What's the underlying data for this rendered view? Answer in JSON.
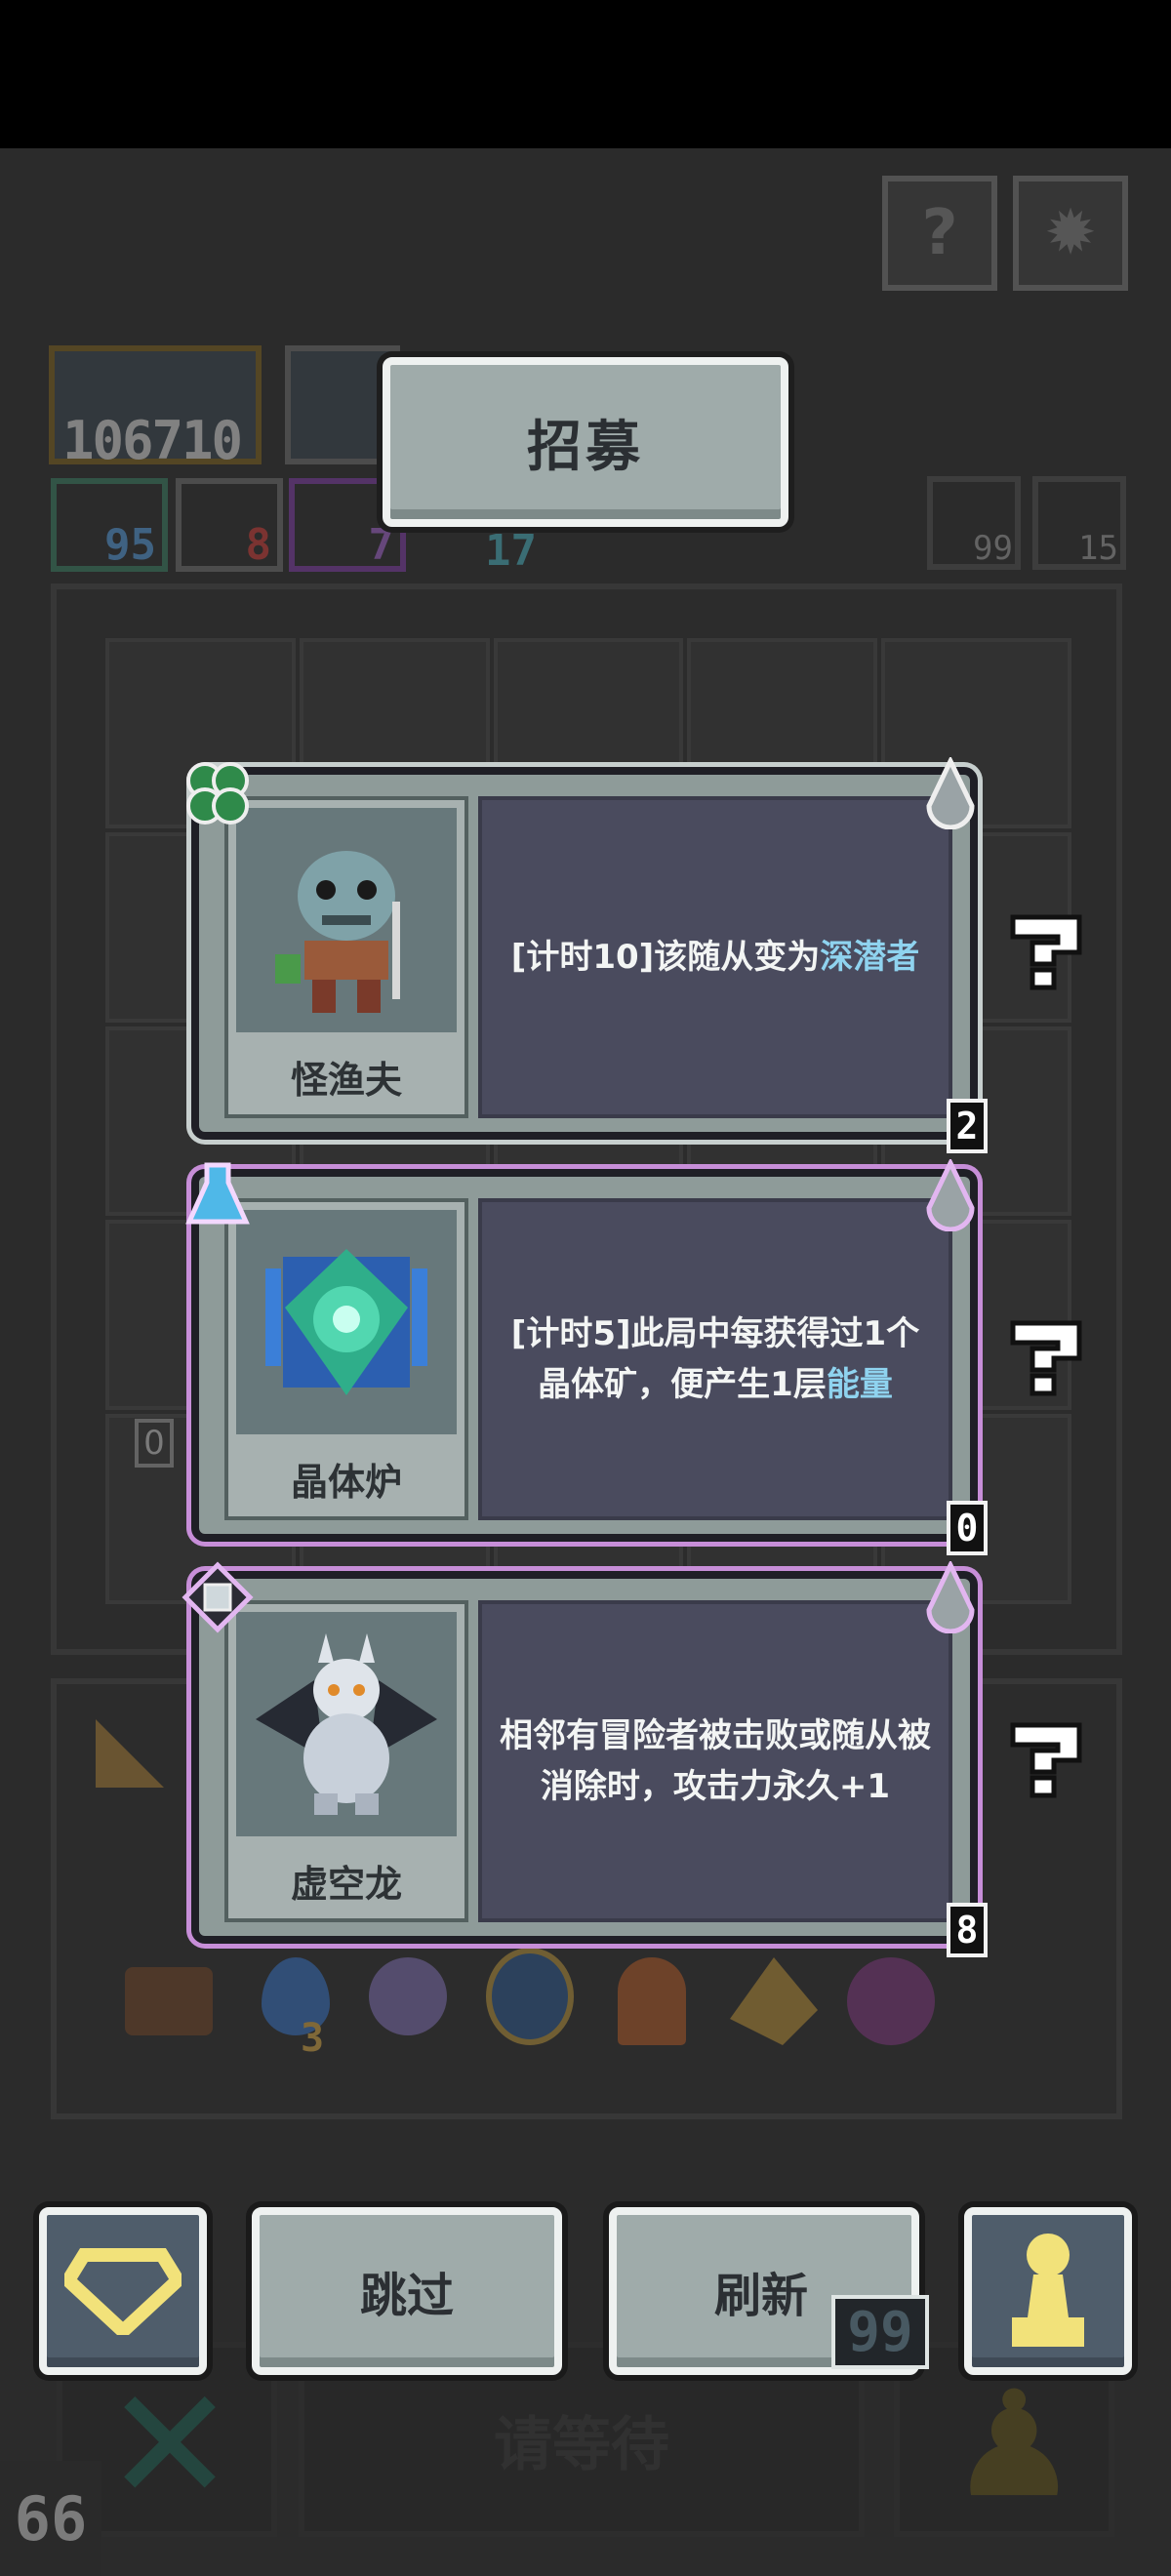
{
  "header": {
    "title": "招募"
  },
  "top_buttons": [
    {
      "icon": "question-mark-icon",
      "label": "?"
    },
    {
      "icon": "gear-icon",
      "label": "✹"
    }
  ],
  "background": {
    "score": "106710",
    "resources": [
      "95",
      "8",
      "7",
      "17"
    ],
    "counters": [
      "99",
      "15"
    ],
    "item_count": "3",
    "slot_badge": "0",
    "waiting_label": "请等待"
  },
  "cards": [
    {
      "name": "怪渔夫",
      "desc_before": "[计时10]该随从变为",
      "desc_highlight": "深潜者",
      "desc_after": "",
      "cost": "2",
      "type_icon": "clover-icon",
      "border": "gray"
    },
    {
      "name": "晶体炉",
      "desc_before": "[计时5]此局中每获得过1个晶体矿，便产生1层",
      "desc_highlight": "能量",
      "desc_after": "",
      "cost": "0",
      "type_icon": "flask-icon",
      "border": "purple"
    },
    {
      "name": "虚空龙",
      "desc_before": "相邻有冒险者被击败或随从被消除时，攻击力永久+1",
      "desc_highlight": "",
      "desc_after": "",
      "cost": "8",
      "type_icon": "gem-frame-icon",
      "border": "purple"
    }
  ],
  "actions": {
    "skip_label": "跳过",
    "refresh_label": "刷新",
    "refresh_count": "99"
  },
  "fps": "66",
  "colors": {
    "highlight": "#8fd3ef",
    "card_purple": "#c78ed8",
    "button": "#9fabaa"
  }
}
